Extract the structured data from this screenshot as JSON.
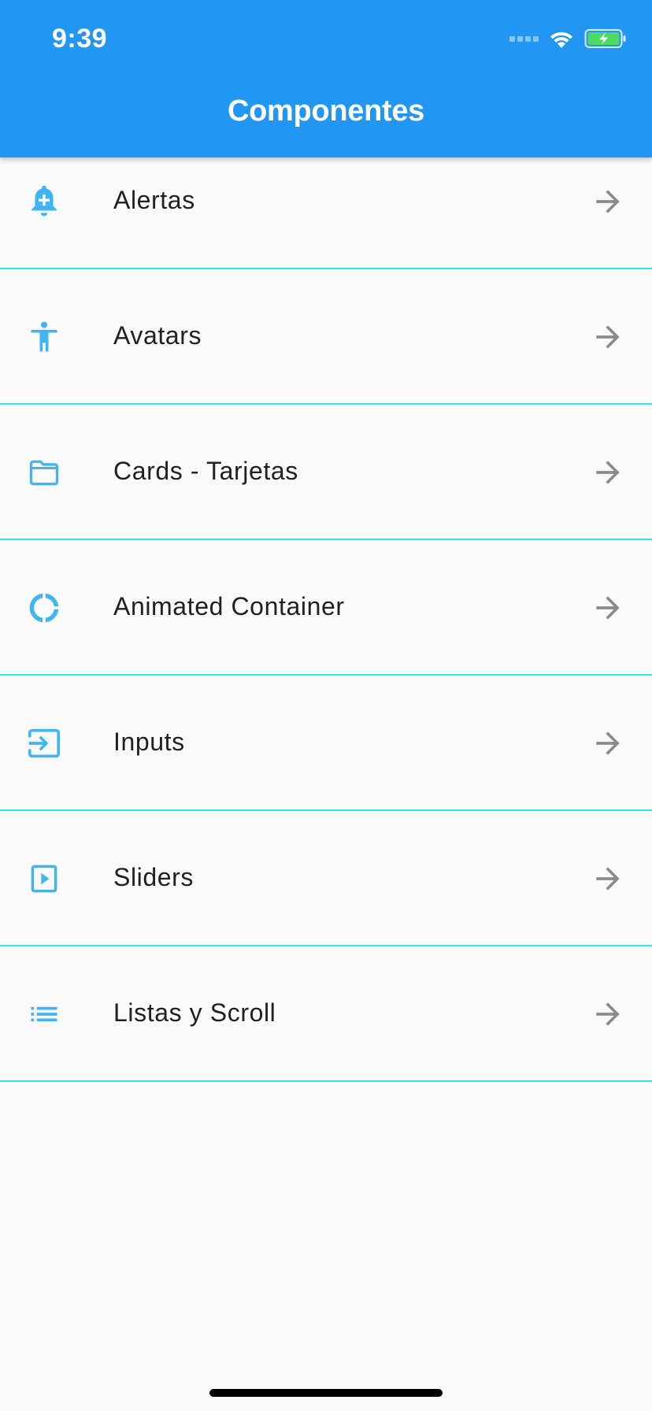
{
  "status_bar": {
    "time": "9:39"
  },
  "app_bar": {
    "title": "Componentes",
    "color": "#2196f3"
  },
  "colors": {
    "icon": "#42b4f0",
    "divider": "#2ee6ec",
    "arrow": "#8a8a8a",
    "background": "#fafafa"
  },
  "items": [
    {
      "label": "Alertas",
      "icon": "add-alert-icon"
    },
    {
      "label": "Avatars",
      "icon": "accessibility-icon"
    },
    {
      "label": "Cards - Tarjetas",
      "icon": "folder-icon"
    },
    {
      "label": "Animated Container",
      "icon": "donut-large-icon"
    },
    {
      "label": "Inputs",
      "icon": "input-icon"
    },
    {
      "label": "Sliders",
      "icon": "slideshow-icon"
    },
    {
      "label": "Listas y Scroll",
      "icon": "list-icon"
    }
  ]
}
